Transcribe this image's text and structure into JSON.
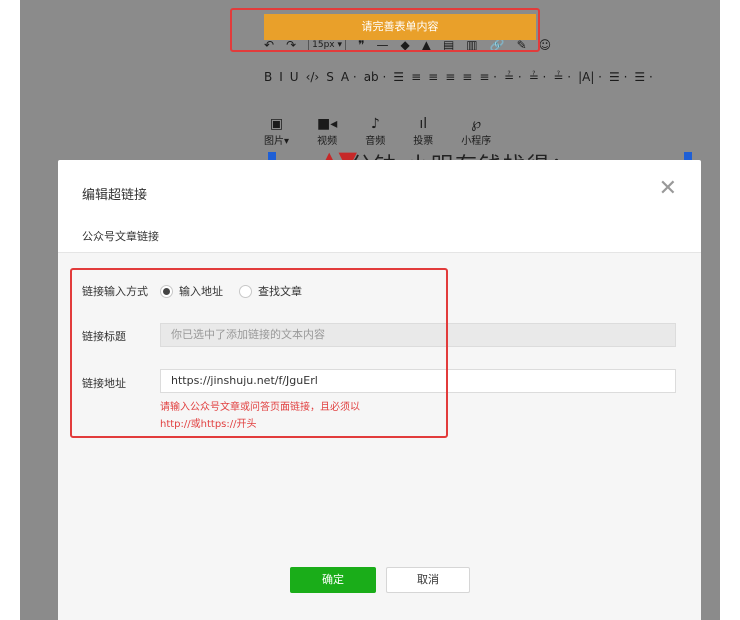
{
  "toast": {
    "text": "请完善表单内容"
  },
  "editor_toolbar": {
    "row1": [
      "↶",
      "↷",
      "15px ▾",
      "❞",
      "—",
      "◆",
      "▲",
      "▤",
      "▥",
      "🔗",
      "✎",
      "☺"
    ],
    "row2": [
      "B",
      "I",
      "U",
      "‹/›",
      "S",
      "A ·",
      "ab ·",
      "☰",
      "≡",
      "≡",
      "≡",
      "≡",
      "≡ ·",
      "≟ ·",
      "≟ ·",
      "≟ ·",
      "|A| ·",
      "☰ ·",
      "☰ ·"
    ],
    "tools": [
      {
        "icon": "image-icon",
        "glyph": "▣",
        "label": "图片▾"
      },
      {
        "icon": "video-icon",
        "glyph": "■◂",
        "label": "视频"
      },
      {
        "icon": "audio-icon",
        "glyph": "♪",
        "label": "音频"
      },
      {
        "icon": "vote-icon",
        "glyph": "ıl",
        "label": "投票"
      },
      {
        "icon": "miniprogram-icon",
        "glyph": "℘",
        "label": "小程序"
      }
    ],
    "partial_text": "分钟    小明有钱找得："
  },
  "dialog": {
    "title": "编辑超链接",
    "close_glyph": "✕",
    "tab": "公众号文章链接",
    "method_label": "链接输入方式",
    "method_options": [
      {
        "label": "输入地址",
        "selected": true
      },
      {
        "label": "查找文章",
        "selected": false
      }
    ],
    "title_label": "链接标题",
    "title_placeholder": "你已选中了添加链接的文本内容",
    "url_label": "链接地址",
    "url_value": "https://jinshuju.net/f/JguErl",
    "error_line1": "请输入公众号文章或问答页面链接，且必须以",
    "error_line2": "http://或https://开头",
    "ok_label": "确定",
    "cancel_label": "取消"
  },
  "colors": {
    "accent_green": "#1aad19",
    "tab_underline": "#07c160",
    "error_red": "#e14040",
    "toast_orange": "#e9a02a",
    "highlight_red": "#e23b3b"
  }
}
